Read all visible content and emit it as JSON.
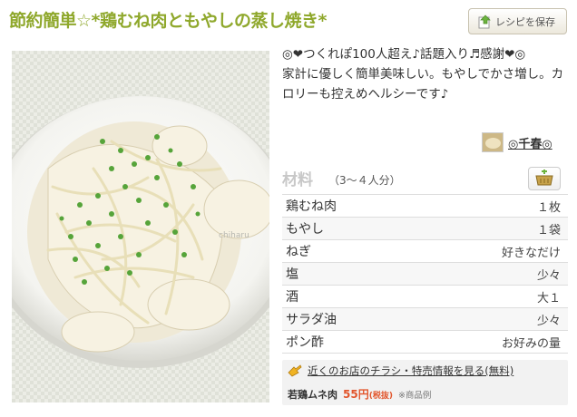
{
  "recipe": {
    "title": "節約簡単☆*鶏むね肉ともやしの蒸し焼き*",
    "save_label": "レシピを保存",
    "photo_watermark": "chiharu",
    "description": "◎❤つくれぽ100人超え♪話題入り♬感謝❤◎\n家計に優しく簡単美味しい。もやしでかさ増し。カロリーも控えめヘルシーです♪",
    "author": "◎千春◎"
  },
  "ingredients": {
    "title": "材料",
    "servings": "（3〜４人分）",
    "items": [
      {
        "name": "鶏むね肉",
        "amount": "１枚"
      },
      {
        "name": "もやし",
        "amount": "１袋"
      },
      {
        "name": "ねぎ",
        "amount": "好きなだけ"
      },
      {
        "name": "塩",
        "amount": "少々"
      },
      {
        "name": "酒",
        "amount": "大１"
      },
      {
        "name": "サラダ油",
        "amount": "少々"
      },
      {
        "name": "ポン酢",
        "amount": "お好みの量"
      }
    ]
  },
  "promo": {
    "link": "近くのお店のチラシ・特売情報を見る(無料)",
    "item_name": "若鶏ムネ肉",
    "price": "55円",
    "tax_note": "(税抜)",
    "example_note": "※商品例"
  },
  "icons": {
    "save": "save-icon",
    "cart": "add-to-cart-icon",
    "promo": "hand-pointer-icon"
  },
  "colors": {
    "title": "#8fa82c",
    "price": "#e2562d"
  }
}
